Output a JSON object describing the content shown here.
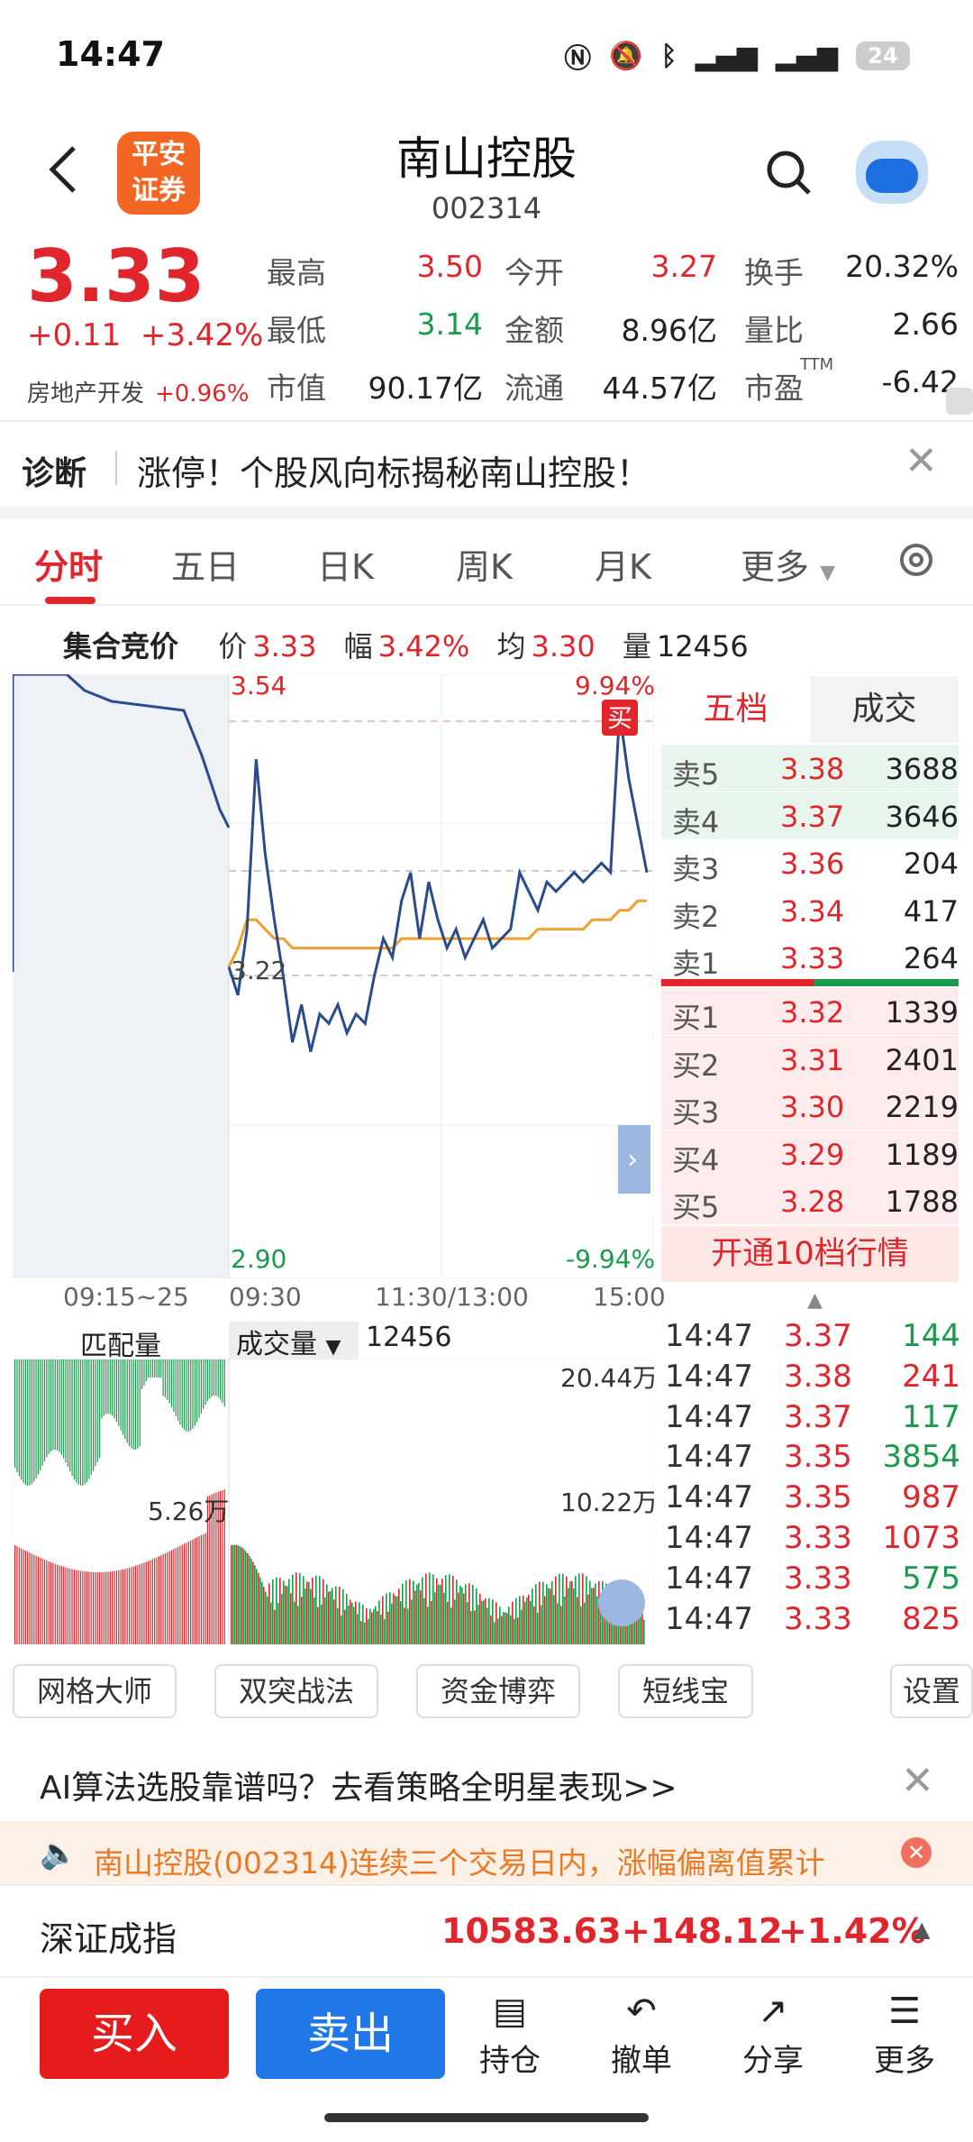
{
  "status": {
    "time": "14:47",
    "battery": "24"
  },
  "header": {
    "title": "南山控股",
    "code": "002314",
    "logo_text": "平安证券"
  },
  "quote": {
    "price": "3.33",
    "change": "+0.11",
    "change_pct": "+3.42%",
    "sector": "房地产开发",
    "sector_pct": "+0.96%",
    "rows": [
      [
        {
          "k": "最高",
          "v": "3.50",
          "c": "red"
        },
        {
          "k": "今开",
          "v": "3.27",
          "c": "red"
        },
        {
          "k": "换手",
          "v": "20.32%",
          "c": "dark"
        }
      ],
      [
        {
          "k": "最低",
          "v": "3.14",
          "c": "green"
        },
        {
          "k": "金额",
          "v": "8.96亿",
          "c": "dark"
        },
        {
          "k": "量比",
          "v": "2.66",
          "c": "dark"
        }
      ],
      [
        {
          "k": "市值",
          "v": "90.17亿",
          "c": "dark"
        },
        {
          "k": "流通",
          "v": "44.57亿",
          "c": "dark"
        },
        {
          "k": "市盈",
          "v": "-6.42",
          "c": "dark"
        }
      ]
    ],
    "pe_sup": "TTM"
  },
  "diagnosis": {
    "label": "诊断",
    "message": "涨停！个股风向标揭秘南山控股！"
  },
  "tabs": [
    "分时",
    "五日",
    "日K",
    "周K",
    "月K",
    "更多"
  ],
  "info": {
    "title": "集合竞价",
    "price_k": "价",
    "price": "3.33",
    "amp_k": "幅",
    "amp": "3.42%",
    "avg_k": "均",
    "avg": "3.30",
    "vol_k": "量",
    "vol": "12456"
  },
  "chart": {
    "top_price": "3.54",
    "top_pct": "9.94%",
    "mid_price": "3.22",
    "bottom_price": "2.90",
    "bottom_pct": "-9.94%",
    "buy_marker": "买",
    "time_labels": [
      "09:15~25",
      "09:30",
      "11:30/13:00",
      "15:00"
    ]
  },
  "chart_data": {
    "type": "line",
    "title": "",
    "ylim": [
      2.9,
      3.54
    ],
    "reference": 3.22,
    "series": [
      {
        "name": "",
        "values": [
          3.23,
          3.2,
          3.27,
          3.45,
          3.35,
          3.28,
          3.22,
          3.15,
          3.19,
          3.14,
          3.18,
          3.17,
          3.19,
          3.16,
          3.18,
          3.17,
          3.22,
          3.26,
          3.24,
          3.3,
          3.33,
          3.26,
          3.32,
          3.28,
          3.25,
          3.27,
          3.24,
          3.26,
          3.28,
          3.25,
          3.26,
          3.27,
          3.33,
          3.31,
          3.29,
          3.32,
          3.31,
          3.32,
          3.33,
          3.32,
          3.33,
          3.34,
          3.33,
          3.5,
          3.43,
          3.38,
          3.33
        ]
      },
      {
        "name": "均",
        "values": [
          3.23,
          3.25,
          3.28,
          3.28,
          3.27,
          3.26,
          3.26,
          3.25,
          3.25,
          3.25,
          3.25,
          3.25,
          3.25,
          3.25,
          3.25,
          3.25,
          3.25,
          3.25,
          3.25,
          3.26,
          3.26,
          3.26,
          3.26,
          3.26,
          3.26,
          3.26,
          3.26,
          3.26,
          3.26,
          3.26,
          3.26,
          3.26,
          3.26,
          3.26,
          3.27,
          3.27,
          3.27,
          3.27,
          3.27,
          3.27,
          3.28,
          3.28,
          3.28,
          3.29,
          3.29,
          3.3,
          3.3
        ]
      }
    ]
  },
  "orderbook": {
    "tabs": [
      "五档",
      "成交"
    ],
    "asks": [
      {
        "l": "卖5",
        "p": "3.38",
        "v": "3688"
      },
      {
        "l": "卖4",
        "p": "3.37",
        "v": "3646"
      },
      {
        "l": "卖3",
        "p": "3.36",
        "v": "204"
      },
      {
        "l": "卖2",
        "p": "3.34",
        "v": "417"
      },
      {
        "l": "卖1",
        "p": "3.33",
        "v": "264"
      }
    ],
    "bids": [
      {
        "l": "买1",
        "p": "3.32",
        "v": "1339"
      },
      {
        "l": "买2",
        "p": "3.31",
        "v": "2401"
      },
      {
        "l": "买3",
        "p": "3.30",
        "v": "2219"
      },
      {
        "l": "买4",
        "p": "3.29",
        "v": "1189"
      },
      {
        "l": "买5",
        "p": "3.28",
        "v": "1788"
      }
    ],
    "upgrade": "开通10档行情"
  },
  "volume": {
    "match_label": "匹配量",
    "vol_label": "成交量",
    "vol_value": "12456",
    "top": "20.44万",
    "mid": "10.22万",
    "auction": "5.26万"
  },
  "trades": [
    {
      "t": "14:47",
      "p": "3.37",
      "v": "144",
      "c": "green"
    },
    {
      "t": "14:47",
      "p": "3.38",
      "v": "241",
      "c": "red"
    },
    {
      "t": "14:47",
      "p": "3.37",
      "v": "117",
      "c": "green"
    },
    {
      "t": "14:47",
      "p": "3.35",
      "v": "3854",
      "c": "green"
    },
    {
      "t": "14:47",
      "p": "3.35",
      "v": "987",
      "c": "red"
    },
    {
      "t": "14:47",
      "p": "3.33",
      "v": "1073",
      "c": "red"
    },
    {
      "t": "14:47",
      "p": "3.33",
      "v": "575",
      "c": "green"
    },
    {
      "t": "14:47",
      "p": "3.33",
      "v": "825",
      "c": "red"
    }
  ],
  "tools": [
    "网格大师",
    "双突战法",
    "资金博弈",
    "短线宝",
    "设置"
  ],
  "ai_banner": "AI算法选股靠谱吗？去看策略全明星表现>>",
  "warning": "南山控股(002314)连续三个交易日内，涨幅偏离值累计",
  "index": {
    "name": "深证成指",
    "value": "10583.63",
    "change": "+148.12",
    "pct": "+1.42%"
  },
  "bottom": {
    "buy": "买入",
    "sell": "卖出",
    "hold": "持仓",
    "cancel": "撤单",
    "share": "分享",
    "more": "更多"
  },
  "colors": {
    "red": "#e0262c",
    "green": "#1a9b4b",
    "blue": "#1f77e8",
    "line": "#2a4b8d",
    "avg": "#f0a030"
  }
}
